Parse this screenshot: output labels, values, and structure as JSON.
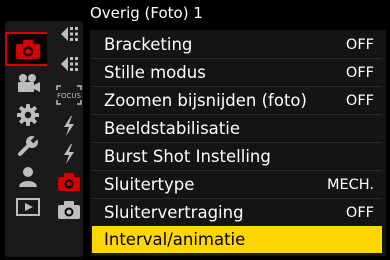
{
  "title": "Overig (Foto) 1",
  "categories": [
    {
      "icon": "camera-icon",
      "selected": true
    },
    {
      "icon": "movie-camera-icon",
      "selected": false
    },
    {
      "icon": "gear-icon",
      "selected": false
    },
    {
      "icon": "wrench-icon",
      "selected": false
    },
    {
      "icon": "person-icon",
      "selected": false
    },
    {
      "icon": "playback-icon",
      "selected": false
    }
  ],
  "subtabs": [
    {
      "icon": "af-page-icon",
      "label": ""
    },
    {
      "icon": "af-page-icon",
      "label": ""
    },
    {
      "icon": "focus-icon",
      "label": "FOCUS"
    },
    {
      "icon": "flash-icon",
      "label": ""
    },
    {
      "icon": "flash-icon",
      "label": ""
    },
    {
      "icon": "camera-other-icon",
      "label": "",
      "active": true
    },
    {
      "icon": "camera-other-icon",
      "label": ""
    }
  ],
  "menu": [
    {
      "label": "Bracketing",
      "value": "OFF"
    },
    {
      "label": "Stille modus",
      "value": "OFF"
    },
    {
      "label": "Zoomen bijsnijden (foto)",
      "value": "OFF"
    },
    {
      "label": "Beeldstabilisatie",
      "value": ""
    },
    {
      "label": "Burst Shot Instelling",
      "value": ""
    },
    {
      "label": "Sluitertype",
      "value": "MECH."
    },
    {
      "label": "Sluitervertraging",
      "value": "OFF"
    },
    {
      "label": "Interval/animatie",
      "value": "",
      "selected": true
    }
  ],
  "colors": {
    "accent_red": "#d50000",
    "highlight": "#ffd700",
    "icon_gray": "#bdbdbd"
  }
}
